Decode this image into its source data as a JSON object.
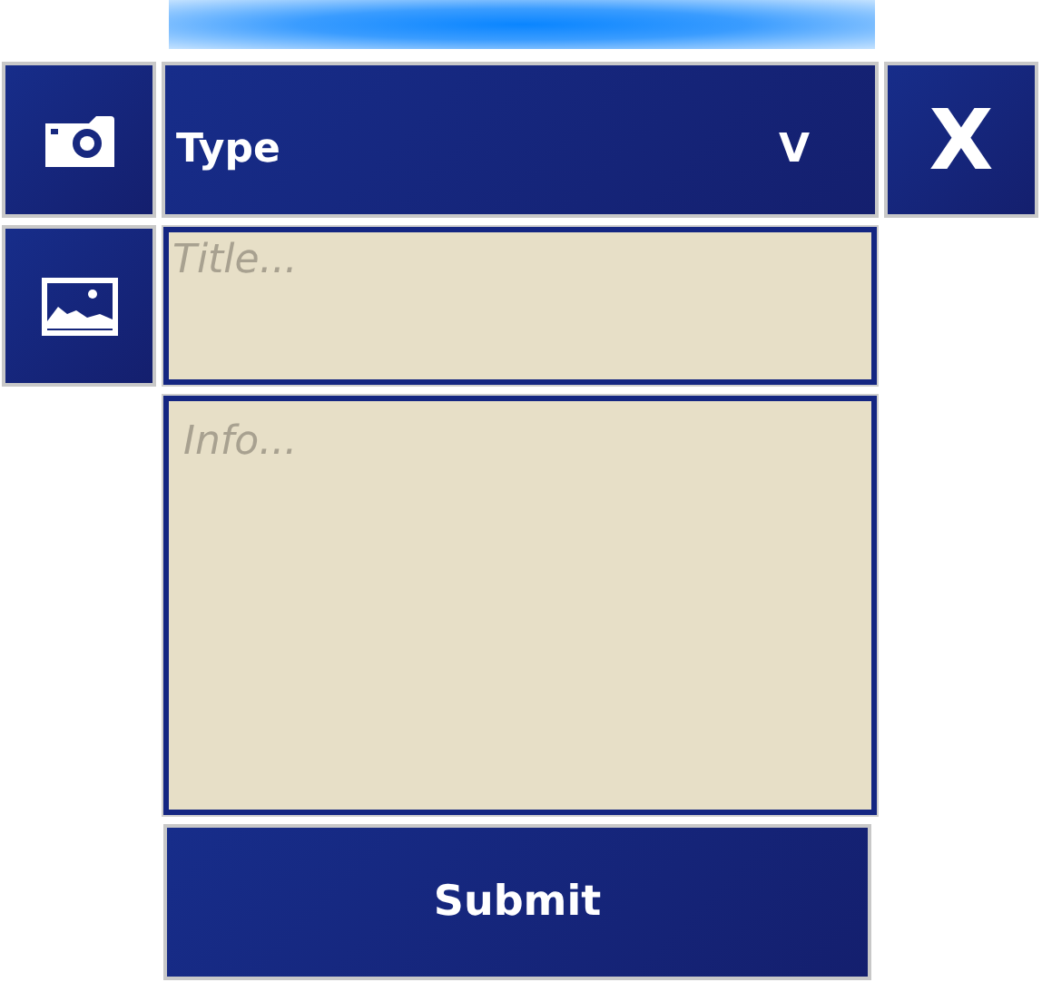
{
  "type_dropdown": {
    "label": "Type",
    "caret": "V"
  },
  "close_button": {
    "label": "X"
  },
  "title_field": {
    "placeholder": "Title..."
  },
  "info_field": {
    "placeholder": "Info..."
  },
  "submit_button": {
    "label": "Submit"
  }
}
